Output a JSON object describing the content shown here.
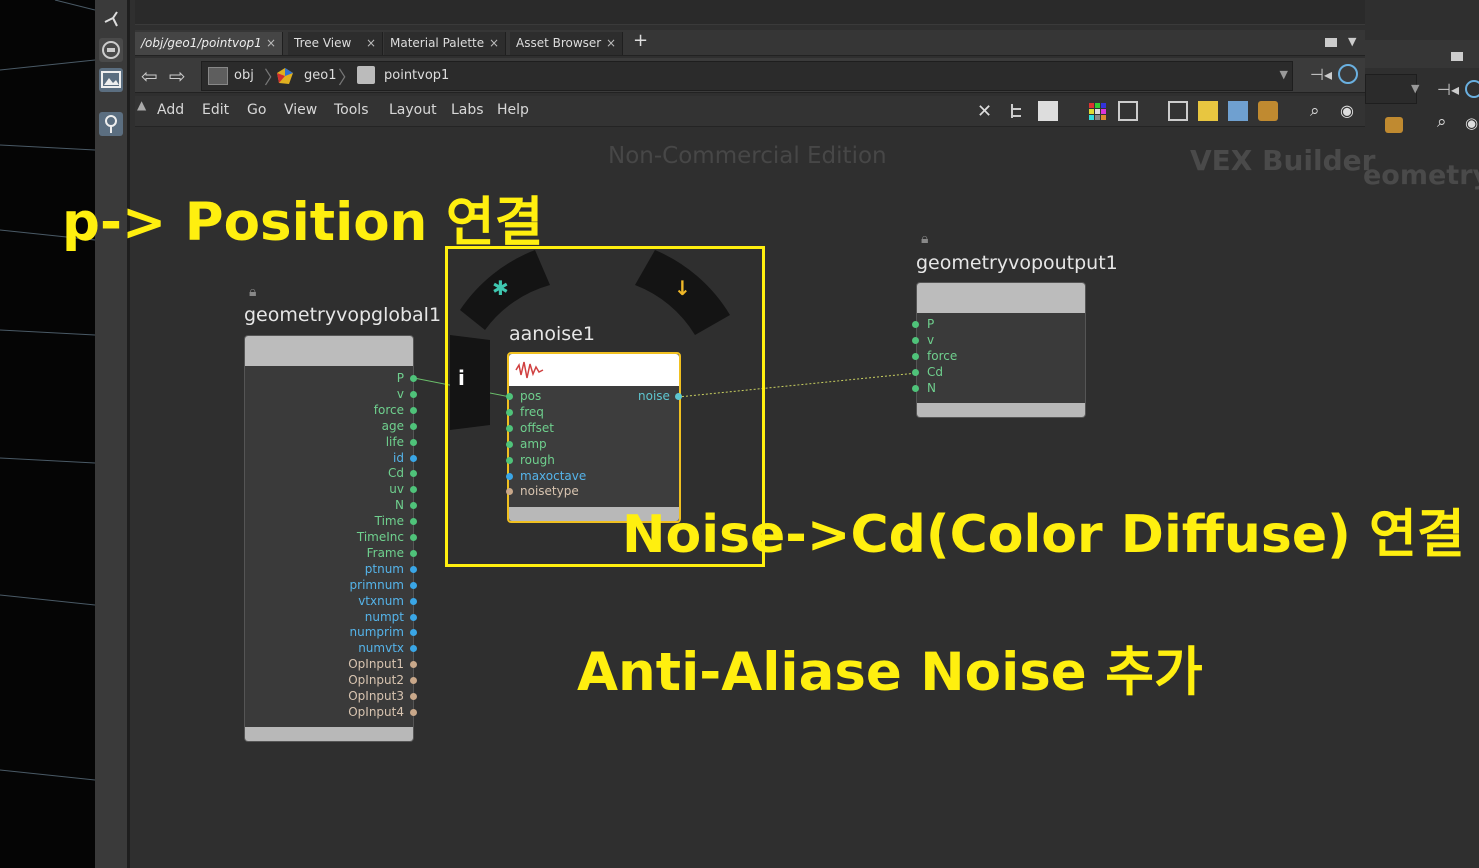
{
  "tabs": [
    {
      "label": "/obj/geo1/pointvop1",
      "active": true
    },
    {
      "label": "Tree View",
      "active": false
    },
    {
      "label": "Material Palette",
      "active": false
    },
    {
      "label": "Asset Browser",
      "active": false
    }
  ],
  "tab_close": "×",
  "tab_add": "+",
  "path": {
    "obj": "obj",
    "geo1": "geo1",
    "pointvop1": "pointvop1"
  },
  "menu": [
    "Add",
    "Edit",
    "Go",
    "View",
    "Tools",
    "Layout",
    "Labs",
    "Help"
  ],
  "watermark": {
    "edition": "Non-Commercial Edition",
    "context": "VEX Builder",
    "right_partial": "eometry"
  },
  "nodes": {
    "global": {
      "name": "geometryvopglobal1",
      "outputs": [
        "P",
        "v",
        "force",
        "age",
        "life",
        "id",
        "Cd",
        "uv",
        "N",
        "Time",
        "TimeInc",
        "Frame",
        "ptnum",
        "primnum",
        "vtxnum",
        "numpt",
        "numprim",
        "numvtx",
        "OpInput1",
        "OpInput2",
        "OpInput3",
        "OpInput4"
      ]
    },
    "noise": {
      "name": "aanoise1",
      "inputs": [
        "pos",
        "freq",
        "offset",
        "amp",
        "rough",
        "maxoctave",
        "noisetype"
      ],
      "output": "noise",
      "info_icon": "i"
    },
    "output": {
      "name": "geometryvopoutput1",
      "inputs": [
        "P",
        "v",
        "force",
        "Cd",
        "N"
      ]
    }
  },
  "annotations": {
    "a1": "p-> Position 연결",
    "a2": "Noise->Cd(Color Diffuse) 연결",
    "a3": "Anti-Aliase Noise 추가"
  },
  "colors": {
    "annotation": "#ffef0f",
    "background": "#2f2f2f",
    "port_green": "#4fc37a",
    "port_blue": "#3aa6e6",
    "port_tan": "#c9a88a"
  }
}
